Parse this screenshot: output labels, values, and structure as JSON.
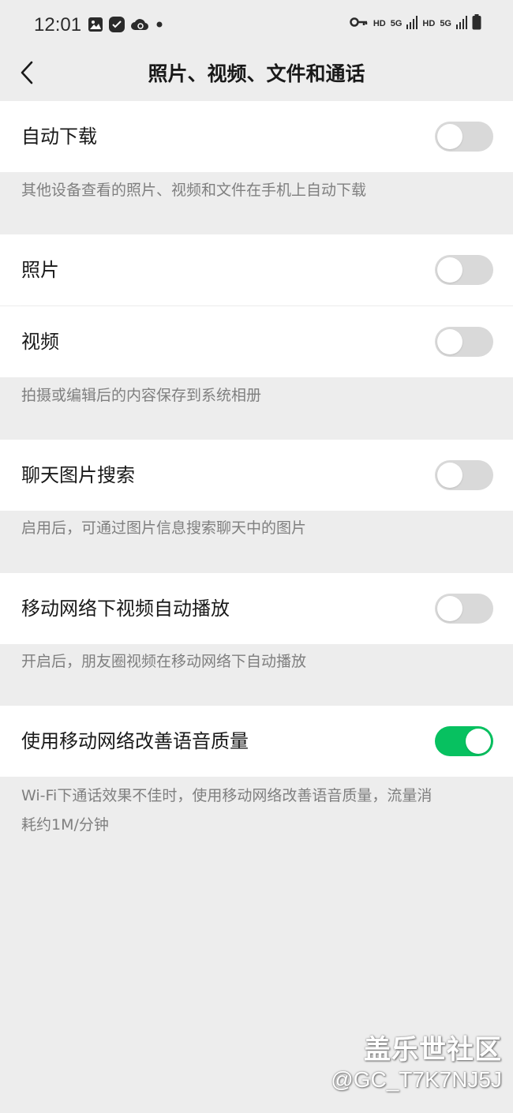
{
  "status_bar": {
    "time": "12:01",
    "hd1": "HD",
    "net1": "5G",
    "hd2": "HD",
    "net2": "5G"
  },
  "nav": {
    "title": "照片、视频、文件和通话"
  },
  "settings": {
    "auto_download": {
      "label": "自动下载",
      "on": false,
      "description": "其他设备查看的照片、视频和文件在手机上自动下载"
    },
    "photos": {
      "label": "照片",
      "on": false
    },
    "videos": {
      "label": "视频",
      "on": false,
      "description": "拍摄或编辑后的内容保存到系统相册"
    },
    "chat_image_search": {
      "label": "聊天图片搜索",
      "on": false,
      "description": "启用后，可通过图片信息搜索聊天中的图片"
    },
    "mobile_video_autoplay": {
      "label": "移动网络下视频自动播放",
      "on": false,
      "description": "开启后，朋友圈视频在移动网络下自动播放"
    },
    "improve_voice": {
      "label": "使用移动网络改善语音质量",
      "on": true,
      "description_line1": "Wi-Fi下通话效果不佳时，使用移动网络改善语音质量，流量消",
      "description_line2": "耗约1M/分钟"
    }
  },
  "watermark": {
    "brand": "盖乐世社区",
    "user": "@GC_T7K7NJ5J"
  },
  "colors": {
    "background": "#ededed",
    "switch_on": "#07c160",
    "switch_off": "#d9d9d9"
  }
}
